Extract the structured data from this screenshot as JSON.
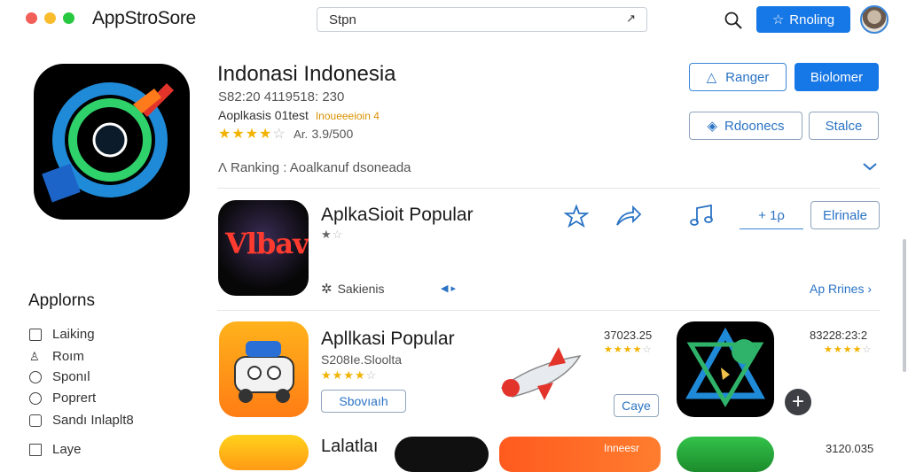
{
  "window": {
    "title": "AppStroSore",
    "controls": {
      "close": "#f25f58",
      "minimize": "#f8bc2d",
      "maximize": "#27c840"
    }
  },
  "search": {
    "value": "Stpn",
    "clear_glyph": "↗"
  },
  "header": {
    "primary_button": "Rnoling",
    "search_icon": "search-icon",
    "avatar_icon": "user-avatar"
  },
  "app": {
    "name": "Indonasi Indonesia",
    "meta_line": "S82:20 4119518: 230",
    "category": "Aoplkasis 01test",
    "badge": "Inoueeeioin 4",
    "rating_value": "3.9/500",
    "rating_prefix": "Ar.",
    "rating_stars": 4,
    "ranking": "Ranking : Aoalkanuf dsoneada",
    "buttons": {
      "ranger": "Ranger",
      "download": "Biolomer",
      "rdoonecs": "Rdoonecs",
      "stalce": "Stalce"
    }
  },
  "popular_section": {
    "title": "AplkaSioit Popular",
    "stars": 1,
    "tag": "Sakienis",
    "counter": "+ 1ρ",
    "action_button": "Elrinale",
    "see_all": "Ap Rrines",
    "icon_caption": "Vlbav"
  },
  "sidebar": {
    "heading": "Applorns",
    "items": [
      {
        "label": "Laiking",
        "icon": "tray-icon"
      },
      {
        "label": "Roım",
        "icon": "person-icon"
      },
      {
        "label": "Sponıl",
        "icon": "circle-icon"
      },
      {
        "label": "Poprert",
        "icon": "circle-icon"
      },
      {
        "label": "Sandı Inlaplt8",
        "icon": "camera-icon"
      },
      {
        "label": "Laye",
        "icon": "page-icon"
      }
    ]
  },
  "list": [
    {
      "title": "Apllkasi Popular",
      "subtitle": "S208Ie.Sloolta",
      "stars": 4,
      "button": "Sbovıaıh",
      "count": "37023.25",
      "count_stars": 4,
      "get_button": "Caye"
    },
    {
      "count": "83228:23:2",
      "count_stars": 4
    }
  ],
  "bottom_row": {
    "title": "Lalatlaı",
    "badge": "Inneesr",
    "count": "3120.035"
  }
}
